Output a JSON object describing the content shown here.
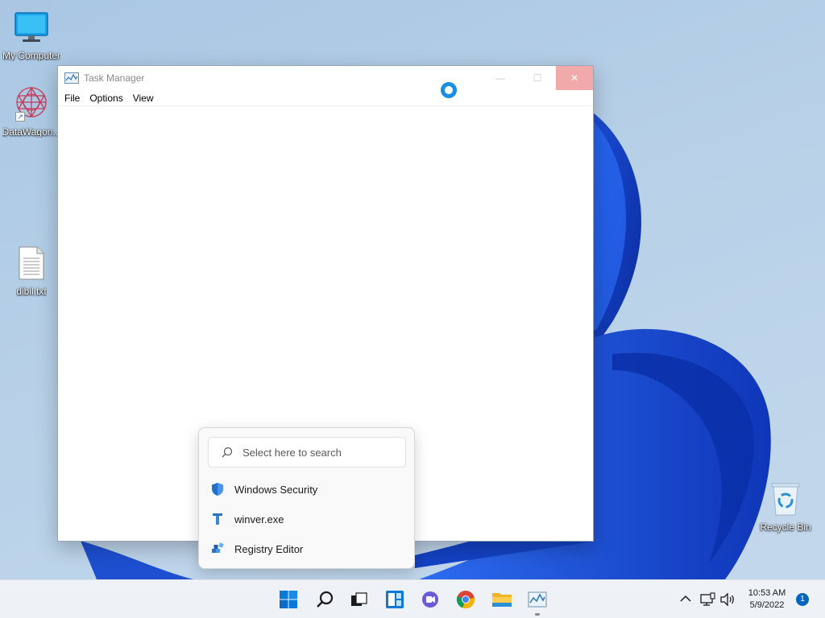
{
  "desktop": {
    "icons": [
      {
        "label": "My Computer",
        "icon": "monitor-icon"
      },
      {
        "label": "DataWagon...",
        "icon": "datawagon-icon"
      },
      {
        "label": "dibil.txt",
        "icon": "text-file-icon"
      }
    ],
    "recycle_bin": {
      "label": "Recycle Bin",
      "icon": "recycle-bin-icon"
    }
  },
  "window": {
    "title": "Task Manager",
    "menu": [
      "File",
      "Options",
      "View"
    ],
    "controls": {
      "minimize": "—",
      "maximize": "☐",
      "close": "✕"
    }
  },
  "search_popup": {
    "placeholder": "Select here to search",
    "items": [
      {
        "label": "Windows Security",
        "icon": "shield-icon"
      },
      {
        "label": "winver.exe",
        "icon": "exe-icon"
      },
      {
        "label": "Registry Editor",
        "icon": "registry-icon"
      }
    ]
  },
  "taskbar": {
    "apps": [
      "start-icon",
      "search-icon",
      "task-view-icon",
      "widgets-icon",
      "chat-icon",
      "chrome-icon",
      "file-explorer-icon",
      "task-manager-icon"
    ],
    "clock": {
      "time": "10:53 AM",
      "date": "5/9/2022"
    },
    "notification_count": "1"
  },
  "colors": {
    "accent": "#0067c0",
    "close_hover": "#f2a9a9",
    "spinner": "#1a8fe3"
  }
}
